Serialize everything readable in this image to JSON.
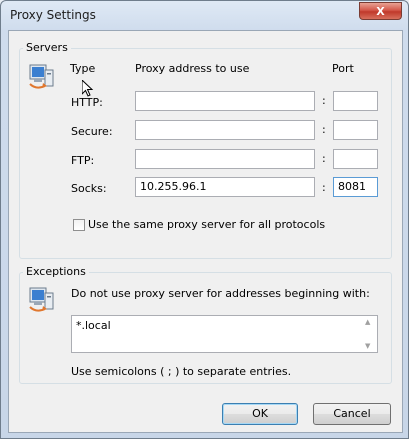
{
  "window": {
    "title": "Proxy Settings",
    "close_label": "X"
  },
  "servers": {
    "group_label": "Servers",
    "col_type": "Type",
    "col_address": "Proxy address to use",
    "col_port": "Port",
    "separator": ":",
    "rows": [
      {
        "type": "HTTP:",
        "address": "",
        "port": ""
      },
      {
        "type": "Secure:",
        "address": "",
        "port": ""
      },
      {
        "type": "FTP:",
        "address": "",
        "port": ""
      },
      {
        "type": "Socks:",
        "address": "10.255.96.1",
        "port": "8081"
      }
    ],
    "same_proxy_label": "Use the same proxy server for all protocols",
    "same_proxy_checked": false,
    "icon": "network-computer-icon"
  },
  "exceptions": {
    "group_label": "Exceptions",
    "instruction": "Do not use proxy server for addresses beginning with:",
    "value": "*.local",
    "hint": "Use semicolons ( ; ) to separate entries.",
    "icon": "network-computer-icon"
  },
  "buttons": {
    "ok": "OK",
    "cancel": "Cancel"
  }
}
